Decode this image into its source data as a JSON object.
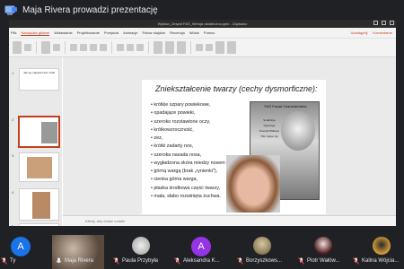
{
  "meeting": {
    "title": "Maja Rivera prowadzi prezentację"
  },
  "powerpoint": {
    "window_title": "Wykład_Zespół FAS_Wersja ostateczna.pptx - Zapisano",
    "tabs": [
      "Plik",
      "Narzędzia główne",
      "Wstawianie",
      "Projektowanie",
      "Przejścia",
      "Animacje",
      "Pokaz slajdów",
      "Recenzja",
      "Widok",
      "Pomoc"
    ],
    "active_tab": "Narzędzia główne",
    "right_actions": [
      "Udostępnij",
      "Komentarze"
    ],
    "notes_placeholder": "Kliknij, aby dodać notatki",
    "thumbnails": [
      {
        "num": "1",
        "caption": "Jak się objawia FAS / FAE",
        "selected": false
      },
      {
        "num": "2",
        "caption": "",
        "selected": true
      },
      {
        "num": "3",
        "caption": "",
        "selected": false
      },
      {
        "num": "4",
        "caption": "",
        "selected": false
      },
      {
        "num": "5",
        "caption": "",
        "selected": false
      }
    ]
  },
  "slide": {
    "title": "Zniekształcenie twarzy (cechy dysmorficzne):",
    "bullets": [
      "krótkie szpary powiekowe,",
      "opadające powieki,",
      "szeroko rozstawione oczy,",
      "krótkowzroczność,",
      "zez,",
      "krótki zadarty nos,",
      "szeroka nasada nosa,",
      "wygładzona skóra miedzy nosem a",
      "górną wargą (brak „rynienki\"),",
      "cienka górna warga,",
      "płaska środkowa część twarzy,",
      "mała, słabo rozwinięta żuchwa."
    ],
    "figure_title": "FAS Facial Characteristics",
    "figure_labels": [
      "Small Eye Openings",
      "Smooth Philtrum",
      "Thin Upper Lip"
    ]
  },
  "participants": [
    {
      "name": "Ty",
      "initial": "A",
      "color": "#1a73e8",
      "type": "avatar",
      "muted": true
    },
    {
      "name": "Maja Rivera",
      "initial": "",
      "color": "#6b5a4e",
      "type": "photo",
      "muted": false
    },
    {
      "name": "Paula Przybyła",
      "initial": "",
      "color": "#d8d8d8",
      "type": "photo",
      "muted": true
    },
    {
      "name": "Aleksandra K...",
      "initial": "A",
      "color": "#9334e6",
      "type": "avatar",
      "muted": true
    },
    {
      "name": "Borzyszkows...",
      "initial": "",
      "color": "#8a7a5a",
      "type": "photo",
      "muted": true
    },
    {
      "name": "Piotr Wałów...",
      "initial": "",
      "color": "#5a2a2a",
      "type": "photo",
      "muted": true
    },
    {
      "name": "Kalina Wójcia...",
      "initial": "",
      "color": "#c88a2a",
      "type": "photo",
      "muted": true
    }
  ],
  "colors": {
    "meet_bg": "#202124",
    "ppt_accent": "#c43e1c",
    "muted_mic": "#ea4335"
  }
}
